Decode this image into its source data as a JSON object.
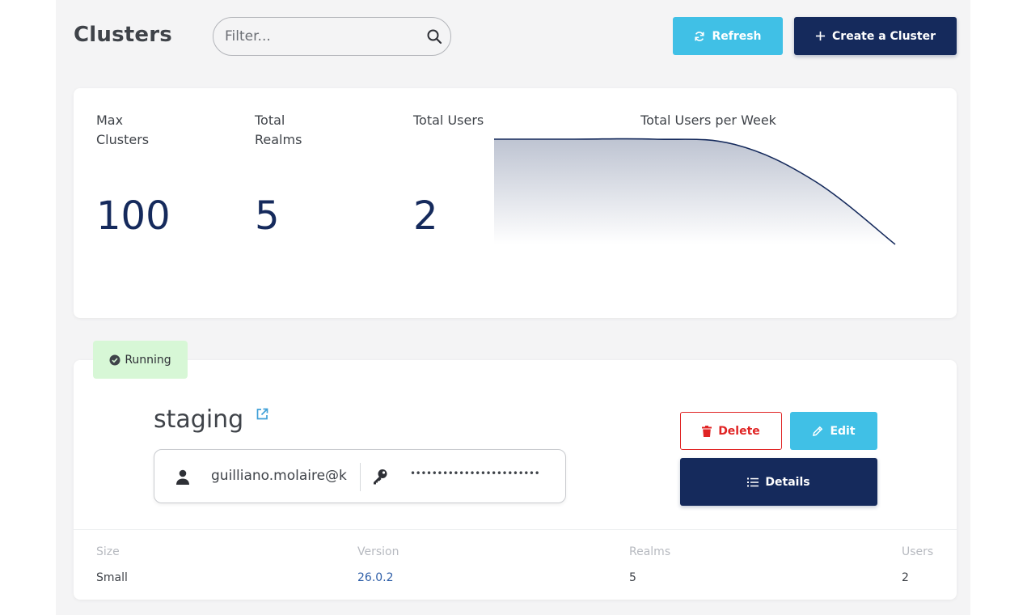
{
  "header": {
    "title": "Clusters",
    "filter_placeholder": "Filter...",
    "refresh_label": "Refresh",
    "create_label": "Create a Cluster"
  },
  "stats": {
    "max_clusters_label": "Max Clusters",
    "max_clusters_value": "100",
    "total_realms_label": "Total Realms",
    "total_realms_value": "5",
    "total_users_label": "Total Users",
    "total_users_value": "2"
  },
  "chart_data": {
    "type": "area",
    "title": "Total Users per Week",
    "x": [
      0,
      1,
      2,
      3,
      4,
      5
    ],
    "series": [
      {
        "values": [
          2,
          2,
          2,
          1.9,
          1.2,
          0.0
        ]
      }
    ],
    "xlabel": "",
    "ylabel": "",
    "grid": false,
    "color": "#152a5c"
  },
  "cluster": {
    "status": "Running",
    "name": "staging",
    "username": "guilliano.molaire@k",
    "password_mask": "••••••••••••••••••••••••",
    "delete_label": "Delete",
    "edit_label": "Edit",
    "details_label": "Details",
    "size_label": "Size",
    "size_value": "Small",
    "version_label": "Version",
    "version_value": "26.0.2",
    "realms_label": "Realms",
    "realms_value": "5",
    "users_label": "Users",
    "users_value": "2"
  },
  "colors": {
    "primary": "#152a5c",
    "accent": "#40c0e6",
    "danger": "#e02424",
    "running_bg": "#d7f7d6"
  }
}
